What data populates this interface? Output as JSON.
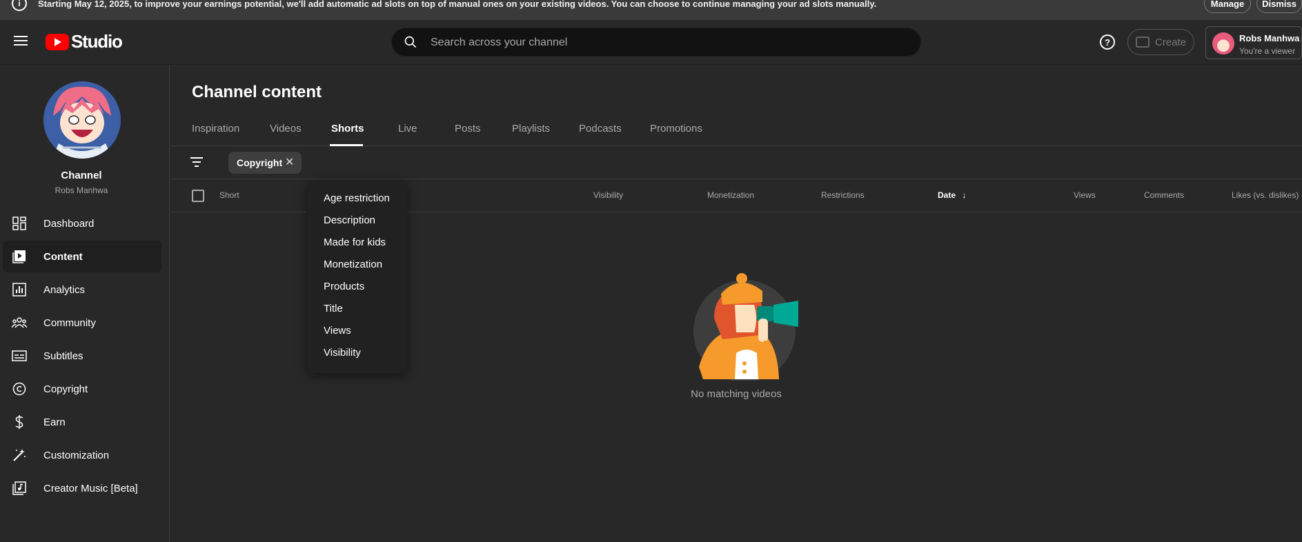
{
  "banner": {
    "message": "Starting May 12, 2025, to improve your earnings potential, we'll add automatic ad slots on top of manual ones on your existing videos. You can choose to continue managing your ad slots manually.",
    "manage_label": "Manage",
    "dismiss_label": "Dismiss",
    "info_icon": "i"
  },
  "header": {
    "logo_text": "Studio",
    "search_placeholder": "Search across your channel",
    "help_icon": "?",
    "create_label": "Create",
    "account_name": "Robs Manhwa",
    "account_role": "You're a viewer"
  },
  "sidebar": {
    "channel_label": "Channel",
    "channel_name": "Robs Manhwa",
    "items": [
      {
        "label": "Dashboard",
        "icon": "dashboard-icon"
      },
      {
        "label": "Content",
        "icon": "content-icon",
        "active": true
      },
      {
        "label": "Analytics",
        "icon": "analytics-icon"
      },
      {
        "label": "Community",
        "icon": "community-icon"
      },
      {
        "label": "Subtitles",
        "icon": "subtitles-icon"
      },
      {
        "label": "Copyright",
        "icon": "copyright-icon"
      },
      {
        "label": "Earn",
        "icon": "earn-icon"
      },
      {
        "label": "Customization",
        "icon": "customization-icon"
      },
      {
        "label": "Creator Music [Beta]",
        "icon": "creator-music-icon"
      }
    ]
  },
  "main": {
    "title": "Channel content",
    "tabs": [
      "Inspiration",
      "Videos",
      "Shorts",
      "Live",
      "Posts",
      "Playlists",
      "Podcasts",
      "Promotions"
    ],
    "active_tab": "Shorts",
    "filter_chip": "Copyright",
    "columns": {
      "short": "Short",
      "visibility": "Visibility",
      "monetization": "Monetization",
      "restrictions": "Restrictions",
      "date": "Date",
      "views": "Views",
      "comments": "Comments",
      "likes": "Likes (vs. dislikes)"
    },
    "empty_text": "No matching videos"
  },
  "dropdown": {
    "options": [
      "Age restriction",
      "Description",
      "Made for kids",
      "Monetization",
      "Products",
      "Title",
      "Views",
      "Visibility"
    ]
  },
  "colors": {
    "accent_red": "#ff0000",
    "background": "#282828",
    "banner": "#3a3a3a"
  }
}
